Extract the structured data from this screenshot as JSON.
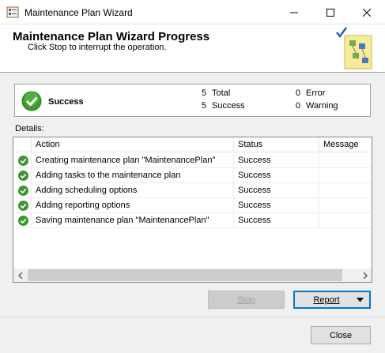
{
  "window": {
    "title": "Maintenance Plan Wizard",
    "controls": {
      "minimize": "minimize-icon",
      "maximize": "maximize-icon",
      "close": "close-icon"
    }
  },
  "header": {
    "title": "Maintenance Plan Wizard Progress",
    "subtitle": "Click Stop to interrupt the operation."
  },
  "summary": {
    "status": "Success",
    "total_count": "5",
    "total_label": "Total",
    "success_count": "5",
    "success_label": "Success",
    "error_count": "0",
    "error_label": "Error",
    "warning_count": "0",
    "warning_label": "Warning"
  },
  "details": {
    "label": "Details:",
    "columns": [
      "Action",
      "Status",
      "Message"
    ],
    "rows": [
      {
        "action": "Creating maintenance plan \"MaintenancePlan\"",
        "status": "Success",
        "message": ""
      },
      {
        "action": "Adding tasks to the maintenance plan",
        "status": "Success",
        "message": ""
      },
      {
        "action": "Adding scheduling options",
        "status": "Success",
        "message": ""
      },
      {
        "action": "Adding reporting options",
        "status": "Success",
        "message": ""
      },
      {
        "action": "Saving maintenance plan \"MaintenancePlan\"",
        "status": "Success",
        "message": ""
      }
    ]
  },
  "buttons": {
    "stop": "Stop",
    "report": "Report",
    "close": "Close"
  },
  "colors": {
    "success_green": "#3c9a2e",
    "accent_blue": "#0078d7"
  }
}
